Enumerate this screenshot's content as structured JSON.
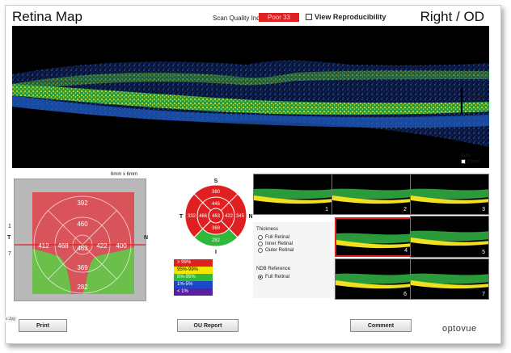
{
  "header": {
    "title": "Retina Map",
    "sqi_label": "Scan Quality Index",
    "sqi_value": "Poor 33",
    "view_reproducibility": "View Reproducibility",
    "eye": "Right / OD"
  },
  "bscan": {
    "scale_label": "250µm",
    "auto_zoom_line1": "Auto",
    "auto_zoom_line2": "Zoom"
  },
  "fundus": {
    "size_label": "6mm x 6mm",
    "left_marker": "T",
    "right_marker": "N",
    "tick_top": "1",
    "tick_bottom": "7",
    "values": {
      "superior_outer": "392",
      "superior_inner": "460",
      "temporal_outer": "412",
      "temporal_inner": "468",
      "center": "463",
      "nasal_inner": "422",
      "nasal_outer": "400",
      "inferior_inner": "369",
      "inferior_outer": "282"
    }
  },
  "sector_chart": {
    "labels": {
      "superior": "S",
      "inferior": "I",
      "temporal": "T",
      "nasal": "N"
    },
    "values": {
      "superior_outer": "380",
      "superior_inner": "446",
      "temporal_outer": "332",
      "temporal_inner": "466",
      "center": "463",
      "nasal_inner": "422",
      "nasal_outer": "345",
      "inferior_inner": "369",
      "inferior_outer": "282"
    },
    "colors": {
      "red": "#e02020",
      "green": "#2fb83a"
    }
  },
  "legend": [
    {
      "label": "> 99%",
      "color": "#e02020",
      "text_color": "#ffffff"
    },
    {
      "label": "95%-99%",
      "color": "#f4e600",
      "text_color": "#000000"
    },
    {
      "label": "5%-95%",
      "color": "#2fb83a",
      "text_color": "#ffffff"
    },
    {
      "label": "1%-5%",
      "color": "#1a49c8",
      "text_color": "#ffffff"
    },
    {
      "label": "< 1%",
      "color": "#5a1fa0",
      "text_color": "#ffffff"
    }
  ],
  "mini_scans": [
    "1",
    "2",
    "3",
    "4",
    "5",
    "6",
    "7"
  ],
  "thickness_panel": {
    "title": "Thickness",
    "options": [
      "Full Retinal",
      "Inner Retinal",
      "Outer Retinal"
    ],
    "ndb_title": "NDB Reference",
    "ndb_option": "Full Retinal"
  },
  "footer": {
    "print": "Print",
    "ou_report": "OU Report",
    "comment": "Comment",
    "logo": "optovue",
    "filename": "s.Jpg"
  }
}
